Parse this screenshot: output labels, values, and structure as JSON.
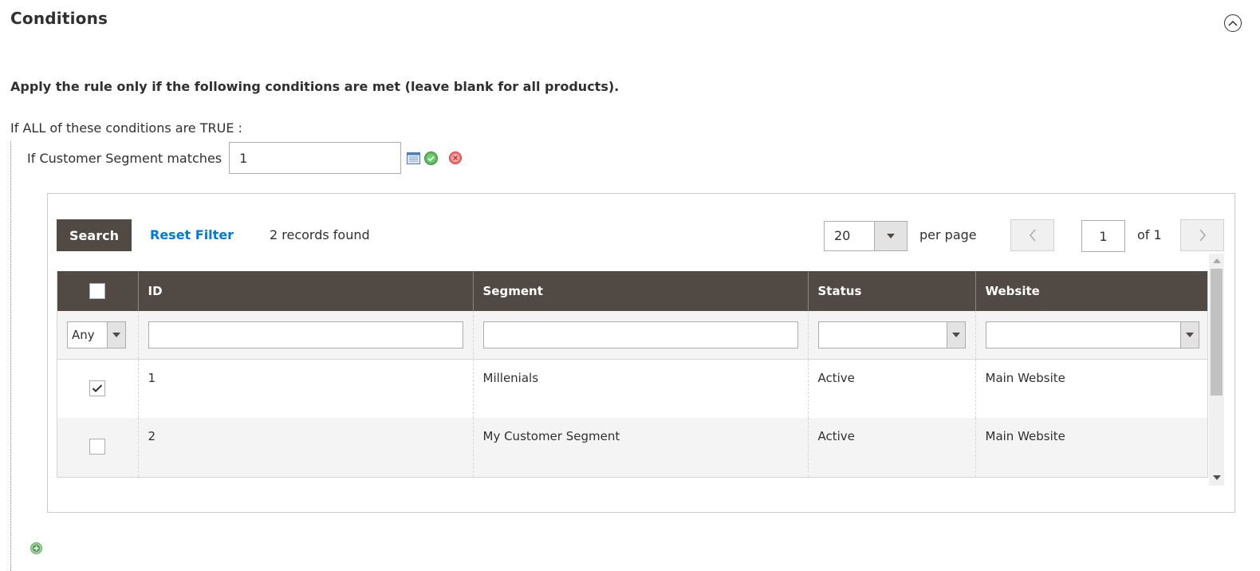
{
  "section": {
    "title": "Conditions",
    "collapse_icon": "chevron-up-circle-icon"
  },
  "intro_text": "Apply the rule only if the following conditions are met (leave blank for all products).",
  "condition_group": {
    "prefix": "If",
    "aggregator": "ALL",
    "middle": " of these conditions are",
    "value": "TRUE",
    "suffix": ":"
  },
  "condition": {
    "label_prefix": "If Customer Segment",
    "operator": "matches",
    "value": "1",
    "icons": [
      "chooser-list-icon",
      "apply-check-icon",
      "remove-x-icon"
    ]
  },
  "chooser": {
    "search_label": "Search",
    "reset_label": "Reset Filter",
    "records_text": "2 records found",
    "per_page_value": "20",
    "per_page_label": "per page",
    "current_page": "1",
    "of_pages": "of 1",
    "columns": [
      {
        "key": "select",
        "label": ""
      },
      {
        "key": "id",
        "label": "ID"
      },
      {
        "key": "segment",
        "label": "Segment"
      },
      {
        "key": "status",
        "label": "Status"
      },
      {
        "key": "website",
        "label": "Website"
      }
    ],
    "filters": {
      "select": "Any",
      "id": "",
      "segment": "",
      "status": "",
      "website": ""
    },
    "rows": [
      {
        "checked": true,
        "id": "1",
        "segment": "Millenials",
        "status": "Active",
        "website": "Main Website"
      },
      {
        "checked": false,
        "id": "2",
        "segment": "My Customer Segment",
        "status": "Active",
        "website": "Main Website"
      }
    ]
  },
  "colors": {
    "header_bg": "#514943",
    "link": "#007bdb",
    "text": "#303030",
    "apply_green": "#4caf50",
    "remove_red": "#e53935"
  }
}
